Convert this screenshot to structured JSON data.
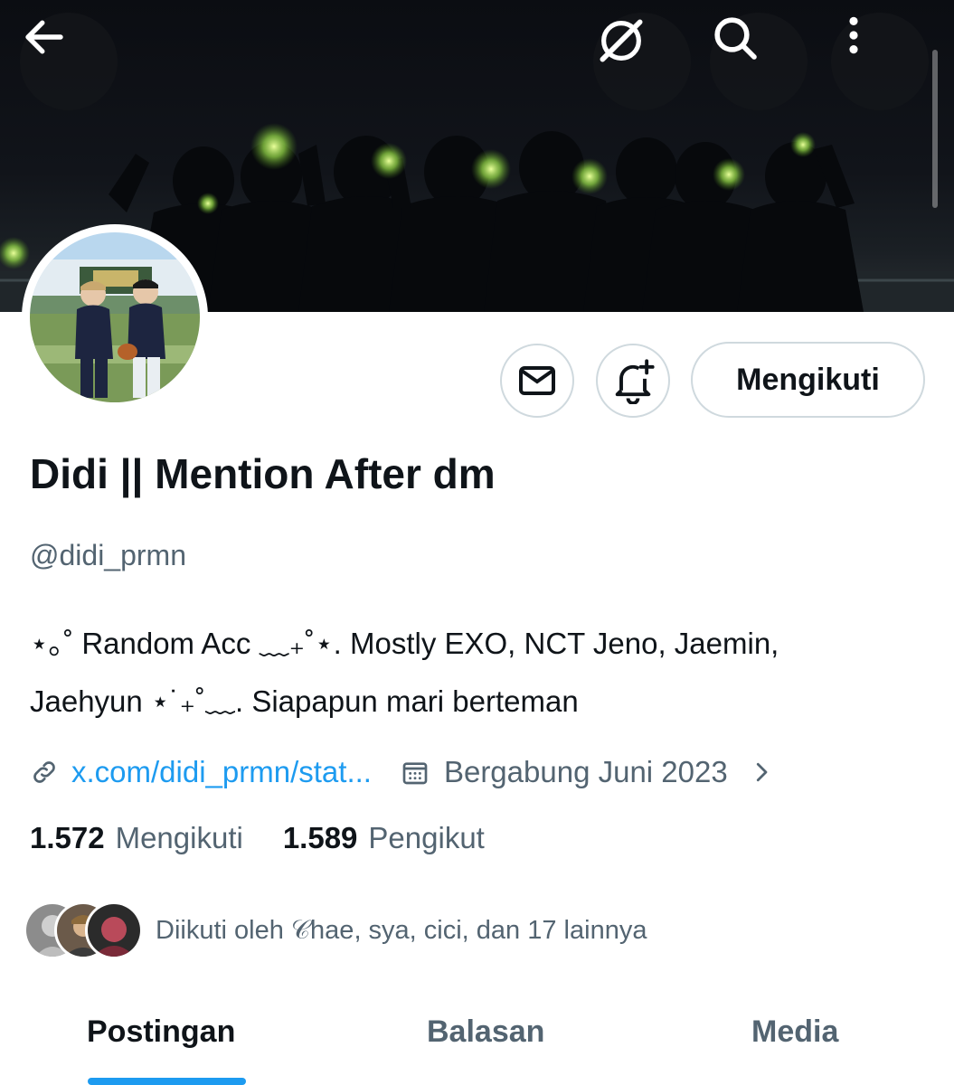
{
  "header": {
    "back_icon": "arrow-left-icon",
    "grok_icon": "grok-icon",
    "search_icon": "search-icon",
    "more_icon": "more-vertical-icon"
  },
  "profile": {
    "name": "Didi || Mention After dm",
    "handle": "@didi_prmn",
    "bio_line1": "⋆｡˚ Random Acc ﹏₊˚⋆. Mostly EXO, NCT Jeno, Jaemin,",
    "bio_line2": "Jaehyun ⋆˙₊˚﹏. Siapapun mari berteman",
    "link": "x.com/didi_prmn/stat...",
    "joined": "Bergabung Juni 2023"
  },
  "actions": {
    "message_icon": "mail-icon",
    "notify_icon": "bell-plus-icon",
    "follow_label": "Mengikuti"
  },
  "stats": {
    "following_count": "1.572",
    "following_label": "Mengikuti",
    "followers_count": "1.589",
    "followers_label": "Pengikut"
  },
  "followed_by": {
    "text_prefix": "Diikuti oleh ",
    "name1": "𝒞hae",
    "text_rest": ", sya, cici, dan 17 lainnya"
  },
  "tabs": [
    {
      "label": "Postingan",
      "active": true
    },
    {
      "label": "Balasan",
      "active": false
    },
    {
      "label": "Media",
      "active": false
    }
  ],
  "colors": {
    "accent": "#1d9bf0",
    "secondary_text": "#536471",
    "primary_text": "#0f1419",
    "border": "#cfd9de"
  }
}
